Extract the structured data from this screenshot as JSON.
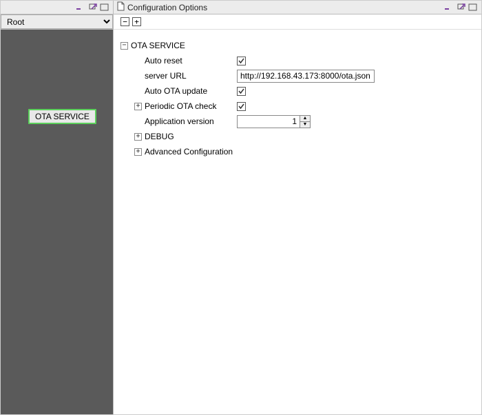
{
  "left": {
    "combo_value": "Root",
    "selected_node": "OTA SERVICE"
  },
  "right": {
    "title": "Configuration Options",
    "toolbar": {
      "collapse_all": "−",
      "expand_all": "+"
    },
    "tree": {
      "root": {
        "label": "OTA SERVICE",
        "expanded": true,
        "children": {
          "auto_reset": {
            "label": "Auto reset",
            "checked": true
          },
          "server_url": {
            "label": "server URL",
            "value": "http://192.168.43.173:8000/ota.json"
          },
          "auto_ota_update": {
            "label": "Auto OTA update",
            "checked": true
          },
          "periodic_check": {
            "label": "Periodic OTA check",
            "checked": true,
            "expandable": true
          },
          "app_version": {
            "label": "Application version",
            "value": "1"
          },
          "debug": {
            "label": "DEBUG",
            "expandable": true
          },
          "advanced": {
            "label": "Advanced Configuration",
            "expandable": true
          }
        }
      }
    }
  },
  "glyphs": {
    "minus": "−",
    "plus": "+"
  }
}
